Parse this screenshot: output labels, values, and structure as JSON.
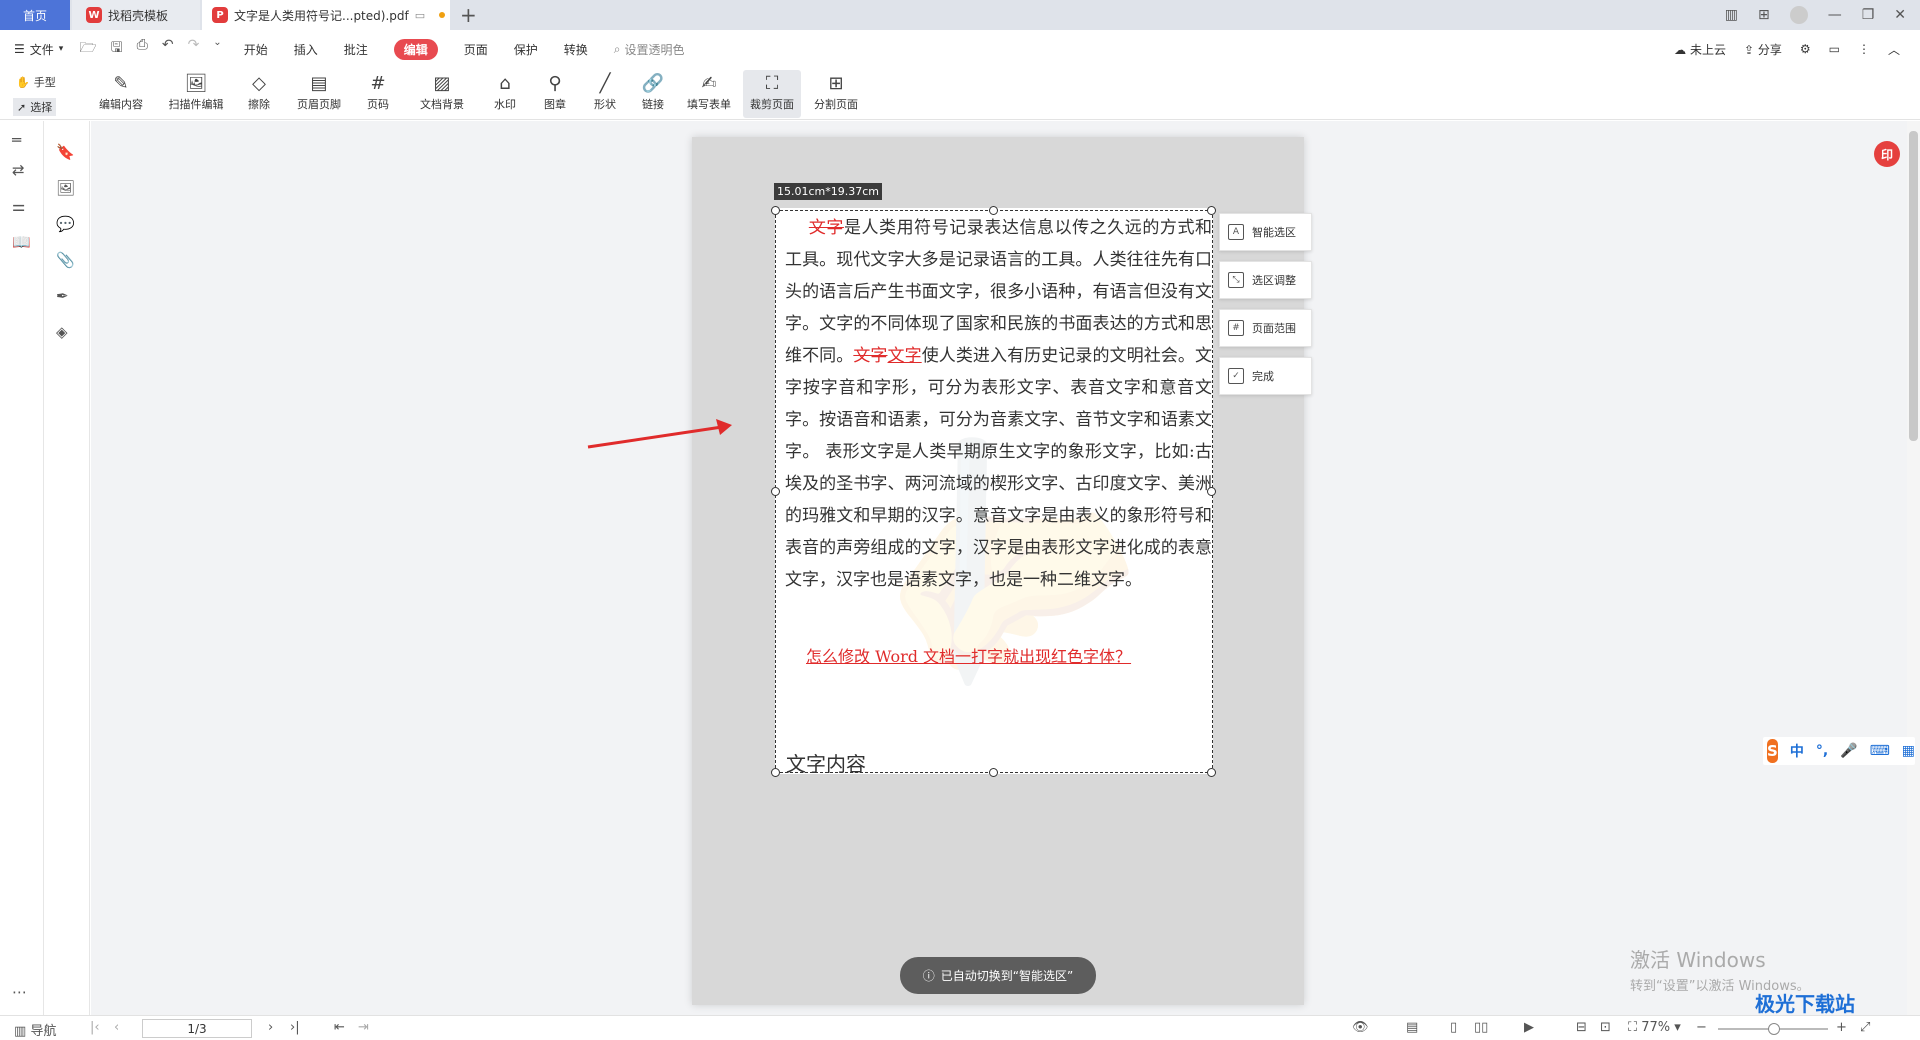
{
  "tabs": {
    "home": "首页",
    "template": "找稻壳模板",
    "document": "文字是人类用符号记...pted).pdf"
  },
  "menu": {
    "file": "文件",
    "items": [
      "开始",
      "插入",
      "批注",
      "编辑",
      "页面",
      "保护",
      "转换"
    ],
    "active_item": "编辑",
    "search_placeholder": "设置透明色",
    "cloud": "未上云",
    "share": "分享"
  },
  "ribbon": {
    "hand": "手型",
    "select": "选择",
    "tools": [
      "编辑内容",
      "扫描件编辑",
      "擦除",
      "页眉页脚",
      "页码",
      "文档背景",
      "水印",
      "图章",
      "形状",
      "链接",
      "填写表单",
      "裁剪页面",
      "分割页面"
    ],
    "selected_tool": "裁剪页面"
  },
  "crop": {
    "size_label": "15.01cm*19.37cm"
  },
  "document": {
    "strike1": "文字",
    "para1": "是人类用符号记录表达信息以传之久远的方式和工具。现代文字大多是记录语言的工具。人类往往先有口头的语言后产生书面文字，很多小语种，有语言但没有文字。文字的不同体现了国家和民族的书面表达的方式和思维不同。",
    "strike2": "文字",
    "under2": "文字",
    "para2": "使人类进入有历史记录的文明社会。文字按字音和字形，可分为表形文字、表音文字和意音文字。按语音和语素，可分为音素文字、音节文字和语素文字。 表形文字是人类早期原生文字的象形文字，比如:古埃及的圣书字、两河流域的楔形文字、古印度文字、美洲的玛雅文和早期的汉字。意音文字是由表义的象形符号和表音的声旁组成的文字，汉字是由表形文字进化成的表意文字，汉字也是语素文字，也是一种二维文字。",
    "link": "怎么修改 Word 文档一打字就出现红色字体？",
    "heading2": "文字内容"
  },
  "side_panel": [
    "智能选区",
    "选区调整",
    "页面范围",
    "完成"
  ],
  "toast": "已自动切换到“智能选区”",
  "badge": "印",
  "ime": [
    "中",
    "°,",
    "🎤",
    "⌨",
    "▦"
  ],
  "windows_activation": {
    "line1": "激活 Windows",
    "line2": "转到“设置”以激活 Windows。"
  },
  "status": {
    "nav": "导航",
    "page": "1/3",
    "zoom": "77%"
  },
  "site_watermark": "极光下载站",
  "colors": {
    "accent": "#e84a50",
    "tab_home": "#4d74d8",
    "red_text": "#e02b2b"
  }
}
